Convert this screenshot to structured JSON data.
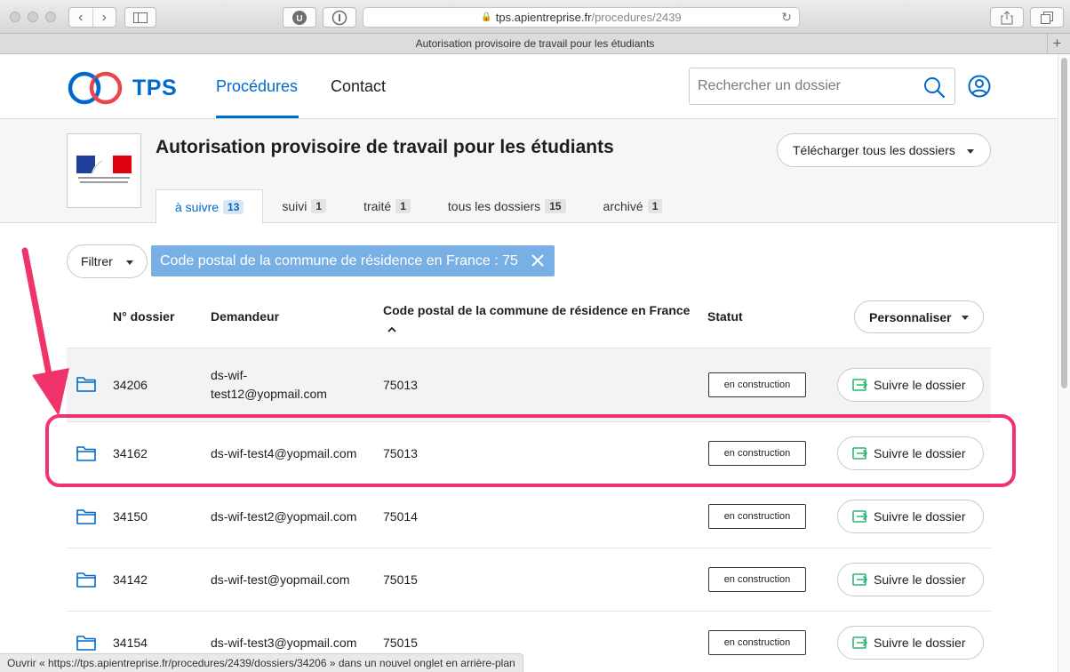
{
  "browser": {
    "url_host": "tps.apientreprise.fr",
    "url_path": "/procedures/2439",
    "tab_title": "Autorisation provisoire de travail pour les étudiants",
    "status_text": "Ouvrir « https://tps.apientreprise.fr/procedures/2439/dossiers/34206 » dans un nouvel onglet en arrière-plan"
  },
  "header": {
    "logo_text": "TPS",
    "nav": {
      "procedures": "Procédures",
      "contact": "Contact"
    },
    "search_placeholder": "Rechercher un dossier"
  },
  "procedure": {
    "title": "Autorisation provisoire de travail pour les étudiants",
    "download_label": "Télécharger tous les dossiers",
    "tabs": [
      {
        "label": "à suivre",
        "count": "13",
        "active": true
      },
      {
        "label": "suivi",
        "count": "1"
      },
      {
        "label": "traité",
        "count": "1"
      },
      {
        "label": "tous les dossiers",
        "count": "15"
      },
      {
        "label": "archivé",
        "count": "1"
      }
    ]
  },
  "filters": {
    "filter_label": "Filtrer",
    "active_filter": "Code postal de la commune de résidence en France : 75"
  },
  "table": {
    "headers": {
      "number": "N° dossier",
      "requester": "Demandeur",
      "postal_line1": "Code postal de la commune de résidence en France",
      "status": "Statut"
    },
    "customize_label": "Personnaliser",
    "follow_label": "Suivre le dossier",
    "rows": [
      {
        "number": "34206",
        "requester_line1": "ds-wif-",
        "requester_line2": "test12@yopmail.com",
        "postal": "75013",
        "status": "en construction"
      },
      {
        "number": "34162",
        "requester": "ds-wif-test4@yopmail.com",
        "postal": "75013",
        "status": "en construction"
      },
      {
        "number": "34150",
        "requester": "ds-wif-test2@yopmail.com",
        "postal": "75014",
        "status": "en construction"
      },
      {
        "number": "34142",
        "requester": "ds-wif-test@yopmail.com",
        "postal": "75015",
        "status": "en construction"
      },
      {
        "number": "34154",
        "requester": "ds-wif-test3@yopmail.com",
        "postal": "75015",
        "status": "en construction"
      }
    ]
  },
  "colors": {
    "primary": "#0069cc",
    "filter_tag": "#78b0e6",
    "highlight": "#f0336b",
    "logo_red": "#e1000f"
  }
}
